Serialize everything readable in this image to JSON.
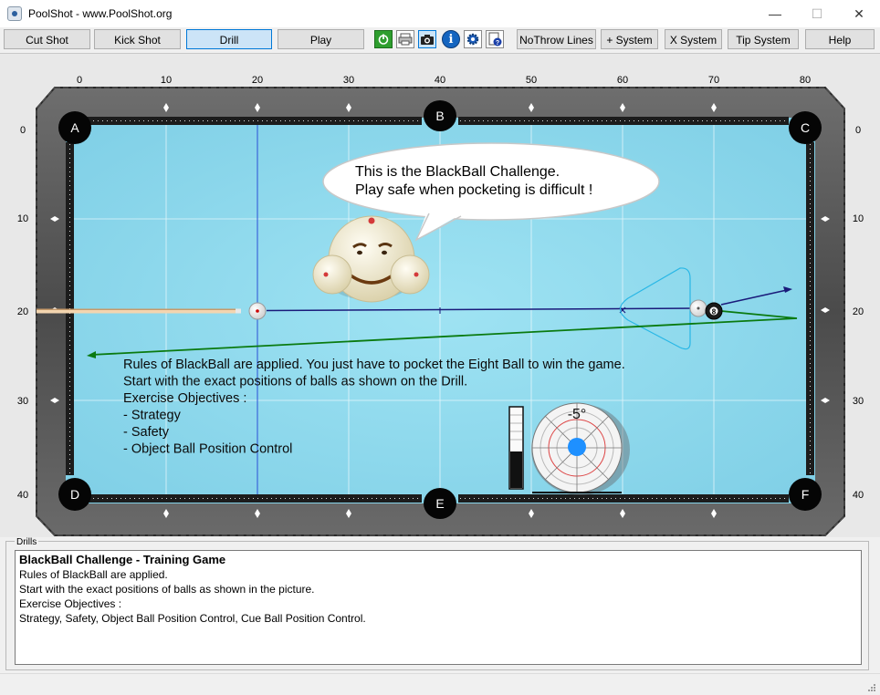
{
  "window": {
    "title": "PoolShot - www.PoolShot.org",
    "minimize": "—",
    "maximize": "☐",
    "close": "✕"
  },
  "toolbar": {
    "cut_shot": "Cut Shot",
    "kick_shot": "Kick Shot",
    "drill": "Drill",
    "play": "Play",
    "icons": [
      "power-icon",
      "print-icon",
      "camera-icon",
      "info-icon",
      "settings-icon",
      "help-document-icon"
    ],
    "no_throw_lines": "NoThrow Lines",
    "plus_system": "+ System",
    "x_system": "X System",
    "tip_system": "Tip System",
    "help": "Help"
  },
  "table": {
    "x_ticks": [
      "0",
      "10",
      "20",
      "30",
      "40",
      "50",
      "60",
      "70",
      "80"
    ],
    "y_ticks": [
      "0",
      "10",
      "20",
      "30",
      "40"
    ],
    "pockets": [
      "A",
      "B",
      "C",
      "D",
      "E",
      "F"
    ],
    "eight_ball": "8",
    "speech_line1": "This is the BlackBall Challenge.",
    "speech_line2": "Play safe when pocketing is difficult !",
    "overlay_lines": [
      "Rules of BlackBall are applied. You just have to pocket the Eight Ball to win the game.",
      "Start with the exact positions of balls as shown on the Drill.",
      "Exercise Objectives :",
      "- Strategy",
      "- Safety",
      "- Object Ball Position Control"
    ],
    "cue_angle": "-5°",
    "power_level": 0.45,
    "colors": {
      "cloth": "#7fd2e8",
      "aim_line": "#1a1a7a",
      "path_line": "#0a7a10",
      "cue_tip_dot": "#1e90ff",
      "rail": "#5c5c5c"
    }
  },
  "drills": {
    "group_label": "Drills",
    "title": "BlackBall Challenge - Training Game",
    "lines": [
      "Rules of BlackBall are applied.",
      "Start with the exact positions of balls as shown in the picture.",
      "Exercise Objectives :",
      "Strategy, Safety, Object Ball Position Control, Cue Ball Position Control."
    ]
  }
}
